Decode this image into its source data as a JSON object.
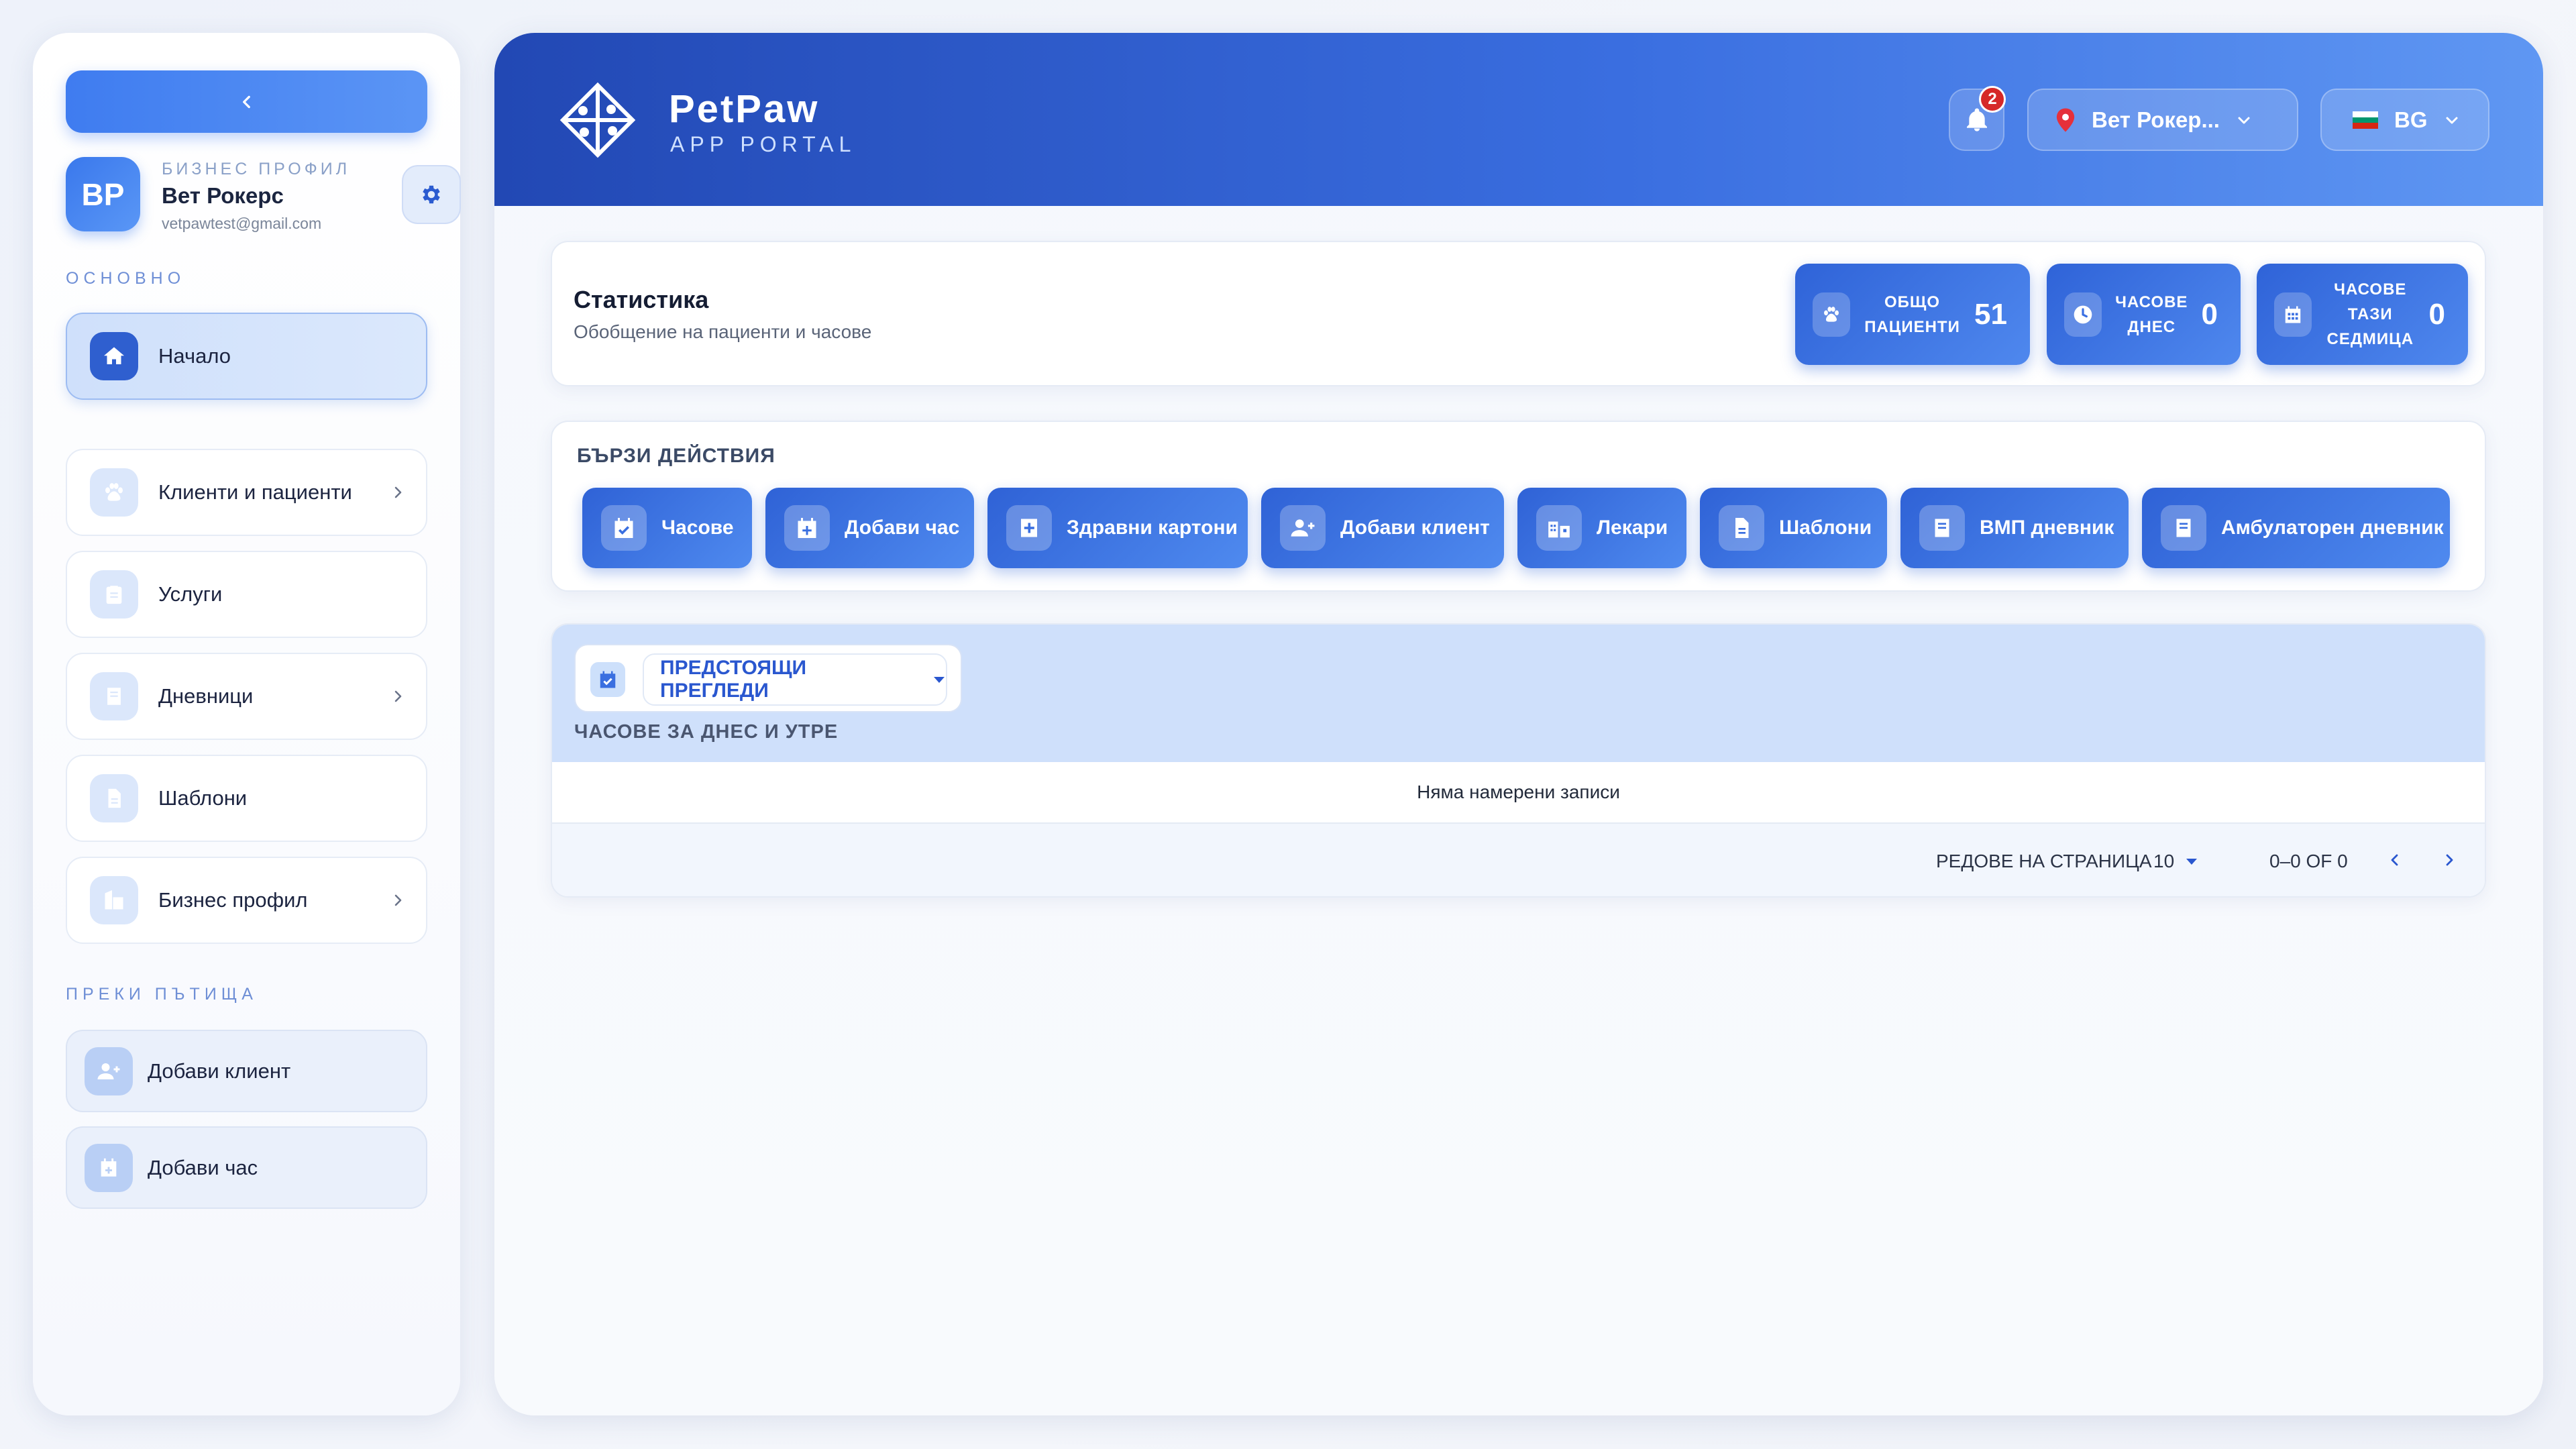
{
  "sidebar": {
    "profile": {
      "initials": "BP",
      "kicker": "БИЗНЕС ПРОФИЛ",
      "name": "Вет Рокерс",
      "email": "vetpawtest@gmail.com"
    },
    "section_main": "ОСНОВНО",
    "items": [
      {
        "label": "Начало",
        "icon": "home-icon",
        "active": true
      },
      {
        "label": "Клиенти и пациенти",
        "icon": "paw-icon"
      },
      {
        "label": "Услуги",
        "icon": "clipboard-icon"
      },
      {
        "label": "Дневници",
        "icon": "book-icon"
      },
      {
        "label": "Шаблони",
        "icon": "document-icon"
      },
      {
        "label": "Бизнес профил",
        "icon": "business-icon"
      }
    ],
    "section_shortcuts": "ПРЕКИ ПЪТИЩА",
    "shortcuts": [
      {
        "label": "Добави клиент",
        "icon": "add-user-icon"
      },
      {
        "label": "Добави час",
        "icon": "calendar-plus-icon"
      }
    ]
  },
  "header": {
    "brand_name": "PetPaw",
    "brand_sub": "APP PORTAL",
    "notifications_count": "2",
    "clinic_select": "Вет Рокер...",
    "language_select": "BG"
  },
  "stats": {
    "title": "Статистика",
    "subtitle": "Обобщение на пациенти и часове",
    "tiles": [
      {
        "line1": "ОБЩО",
        "line2": "ПАЦИЕНТИ",
        "line3": "",
        "value": "51"
      },
      {
        "line1": "ЧАСОВЕ",
        "line2": "ДНЕС",
        "line3": "",
        "value": "0"
      },
      {
        "line1": "ЧАСОВЕ",
        "line2": "ТАЗИ",
        "line3": "СЕДМИЦА",
        "value": "0"
      }
    ]
  },
  "quick_actions": {
    "title": "БЪРЗИ ДЕЙСТВИЯ",
    "buttons": [
      {
        "label": "Часове"
      },
      {
        "label": "Добави час"
      },
      {
        "label": "Здравни картони"
      },
      {
        "label": "Добави клиент"
      },
      {
        "label": "Лекари"
      },
      {
        "label": "Шаблони"
      },
      {
        "label": "ВМП дневник"
      },
      {
        "label": "Амбулаторен дневник"
      }
    ]
  },
  "appointments": {
    "filter": "ПРЕДСТОЯЩИ ПРЕГЛЕДИ",
    "caption": "ЧАСОВЕ ЗА ДНЕС И УТРЕ",
    "empty_text": "Няма намерени записи",
    "rows_per_page_label": "РЕДОВЕ НА СТРАНИЦА",
    "rows_per_page": "10",
    "range": "0–0 OF 0"
  }
}
